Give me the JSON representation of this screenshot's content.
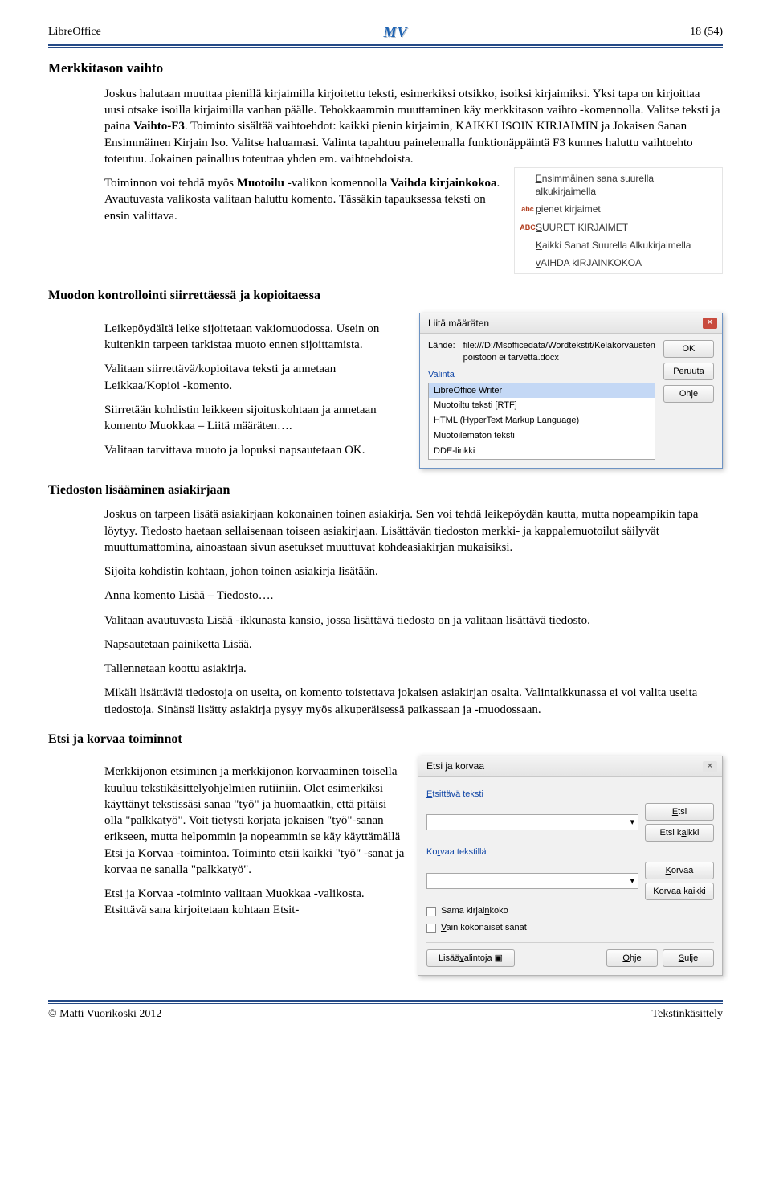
{
  "header": {
    "product": "LibreOffice",
    "page": "18 (54)",
    "logo": "MV"
  },
  "h2_1": "Merkkitason vaihto",
  "p1a": "Joskus halutaan muuttaa pienillä kirjaimilla kirjoitettu teksti, esimerkiksi otsikko, isoiksi kirjaimiksi. Yksi tapa on kirjoittaa uusi otsake isoilla kirjaimilla vanhan päälle. Tehokkaammin muuttaminen käy merkkitason vaihto -komennolla. Valitse teksti ja paina ",
  "p1b": "Vaihto-F3",
  "p1c": ". Toiminto sisältää vaihtoehdot: kaikki pienin kirjaimin, KAIKKI ISOIN KIRJAIMIN ja Jokaisen Sanan Ensimmäinen Kirjain Iso. Valitse haluamasi. Valinta tapahtuu painelemalla funktionäppäintä F3 kunnes haluttu vaihtoehto toteutuu. Jokainen painallus toteuttaa yhden em. vaihtoehdoista.",
  "p2a": "Toiminnon voi tehdä myös ",
  "p2b": "Muotoilu",
  "p2c": " -valikon komennolla ",
  "p2d": "Vaihda kirjainkokoa",
  "p2e": ". Avautuvasta valikosta valitaan haluttu komento. Tässäkin tapauksessa teksti on ensin valittava.",
  "case_menu": {
    "i1": "Ensimmäinen sana suurella alkukirjaimella",
    "i2": "pienet kirjaimet",
    "i3": "SUURET KIRJAIMET",
    "i4": "Kaikki Sanat Suurella Alkukirjaimella",
    "i5": "vAIHDA kIRJAINKOKOA"
  },
  "h3_1": "Muodon kontrollointi siirrettäessä ja kopioitaessa",
  "p3": "Leikepöydältä leike sijoitetaan vakiomuodossa. Usein on kuitenkin tarpeen tarkistaa muoto ennen sijoittamista.",
  "p4": "Valitaan siirrettävä/kopioitava teksti ja annetaan Leikkaa/Kopioi -komento.",
  "p5": "Siirretään kohdistin leikkeen sijoituskohtaan ja annetaan komento Muokkaa – Liitä määräten….",
  "p6": "Valitaan tarvittava muoto ja lopuksi napsautetaan OK.",
  "dlg": {
    "title": "Liitä määräten",
    "src_lbl": "Lähde:",
    "src_val": "file:///D:/Msofficedata/Wordtekstit/Kelakorvausten poistoon ei tarvetta.docx",
    "sel_lbl": "Valinta",
    "items": {
      "a": "LibreOffice Writer",
      "b": "Muotoiltu teksti [RTF]",
      "c": "HTML (HyperText Markup Language)",
      "d": "Muotoilematon teksti",
      "e": "DDE-linkki"
    },
    "ok": "OK",
    "cancel": "Peruuta",
    "help": "Ohje"
  },
  "h3_2": "Tiedoston lisääminen asiakirjaan",
  "p7": "Joskus on tarpeen lisätä asiakirjaan kokonainen toinen asiakirja. Sen voi tehdä leikepöydän kautta, mutta nopeampikin tapa löytyy. Tiedosto haetaan sellaisenaan toiseen asiakirjaan. Lisättävän tiedoston merkki- ja kappalemuotoilut säilyvät muuttumattomina, ainoastaan sivun asetukset muuttuvat kohdeasiakirjan mukaisiksi.",
  "p8": "Sijoita kohdistin kohtaan, johon toinen asiakirja lisätään.",
  "p9": "Anna komento Lisää – Tiedosto….",
  "p10": "Valitaan avautuvasta Lisää -ikkunasta kansio, jossa lisättävä tiedosto on ja valitaan lisättävä tiedosto.",
  "p11": "Napsautetaan painiketta Lisää.",
  "p12": "Tallennetaan koottu asiakirja.",
  "p13": "Mikäli lisättäviä tiedostoja on useita, on komento toistettava jokaisen asiakirjan osalta. Valintaikkunassa ei voi valita useita tiedostoja. Sinänsä lisätty asiakirja pysyy myös alkuperäisessä paikassaan ja -muodossaan.",
  "h3_3": "Etsi ja korvaa toiminnot",
  "p14": "Merkkijonon etsiminen ja merkkijonon korvaaminen toisella kuuluu tekstikäsittelyohjelmien rutiiniin. Olet esimerkiksi käyttänyt tekstissäsi sanaa \"työ\" ja huomaatkin, että pitäisi olla \"palkkatyö\". Voit tietysti korjata jokaisen \"työ\"-sanan erikseen, mutta helpommin ja nopeammin se käy käyttämällä Etsi ja Korvaa -toimintoa. Toiminto etsii kaikki \"työ\" -sanat ja korvaa ne sanalla \"palkkatyö\".",
  "p15": "Etsi ja Korvaa -toiminto valitaan Muokkaa -valikosta. Etsittävä sana kirjoitetaan kohtaan Etsit-",
  "fr": {
    "title": "Etsi ja korvaa",
    "find_lbl": "Etsittävä teksti",
    "replace_lbl": "Korvaa tekstillä",
    "btn_find": "Etsi",
    "btn_findall": "Etsi kaikki",
    "btn_replace": "Korvaa",
    "btn_replaceall": "Korvaa kaikki",
    "cb1": "Sama kirjainkoko",
    "cb2": "Vain kokonaiset sanat",
    "more": "Lisää valintoja",
    "help": "Ohje",
    "close": "Sulje"
  },
  "footer": {
    "copyright": "© Matti Vuorikoski  2012",
    "right": "Tekstinkäsittely"
  }
}
